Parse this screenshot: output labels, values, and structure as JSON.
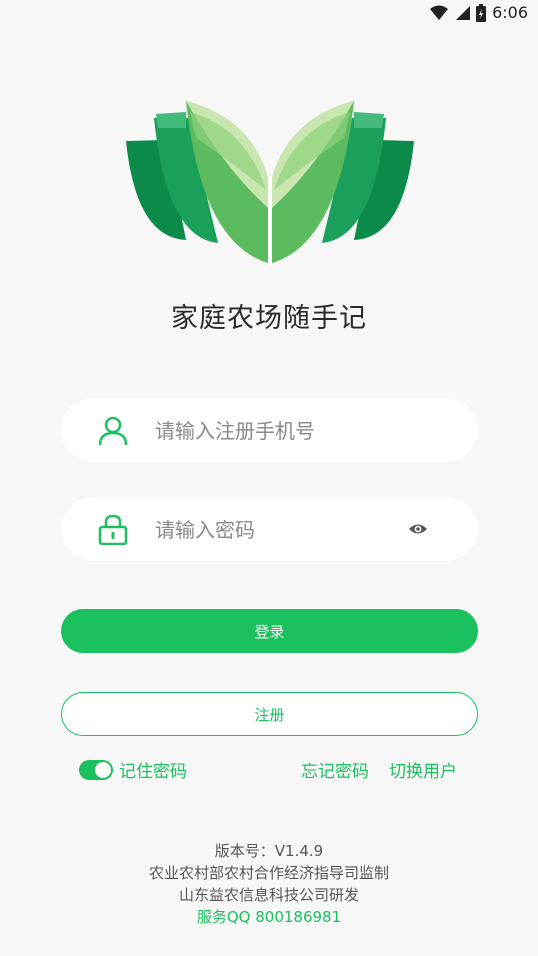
{
  "status_bar": {
    "time": "6:06",
    "icons": [
      "wifi-icon",
      "signal-icon",
      "battery-icon"
    ]
  },
  "app": {
    "title": "家庭农场随手记",
    "logo": "book-leaf-logo"
  },
  "form": {
    "phone_placeholder": "请输入注册手机号",
    "password_placeholder": "请输入密码",
    "login_label": "登录",
    "register_label": "注册",
    "remember_label": "记住密码",
    "remember_on": true,
    "forgot_label": "忘记密码",
    "switch_user_label": "切换用户"
  },
  "footer": {
    "version": "版本号：V1.4.9",
    "supervisor": "农业农村部农村合作经济指导司监制",
    "developer": "山东益农信息科技公司研发",
    "service": "服务QQ 800186981"
  },
  "colors": {
    "accent": "#1bc15f",
    "background": "#f7f7f7"
  }
}
